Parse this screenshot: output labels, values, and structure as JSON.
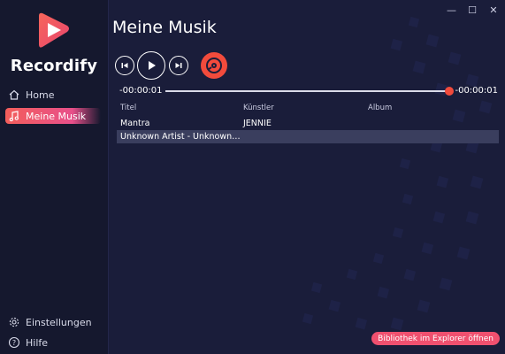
{
  "app": {
    "name": "Recordify",
    "window_controls": {
      "minimize": "—",
      "maximize": "☐",
      "close": "✕"
    }
  },
  "sidebar": {
    "items": [
      {
        "label": "Home",
        "icon": "home-icon"
      },
      {
        "label": "Meine Musik",
        "icon": "music-note-icon",
        "active": true
      }
    ],
    "bottom": [
      {
        "label": "Einstellungen",
        "icon": "gear-icon"
      },
      {
        "label": "Hilfe",
        "icon": "help-icon"
      }
    ]
  },
  "main": {
    "title": "Meine Musik",
    "player": {
      "time_elapsed": "-00:00:01",
      "time_remaining": "-00:00:01",
      "progress": 1.0
    },
    "table": {
      "columns": [
        "Titel",
        "Künstler",
        "Album"
      ],
      "rows": [
        {
          "title": "Mantra",
          "artist": "JENNIE",
          "album": ""
        },
        {
          "title": "Unknown Artist - Unknown…",
          "artist": "",
          "album": "",
          "selected": true
        }
      ]
    },
    "open_library_button": "Bibliothek im Explorer öffnen"
  },
  "colors": {
    "accent": "#f24b3c",
    "background": "#1a1d3a",
    "sidebar": "#15182e",
    "active_nav_gradient": "#f35e5b"
  }
}
